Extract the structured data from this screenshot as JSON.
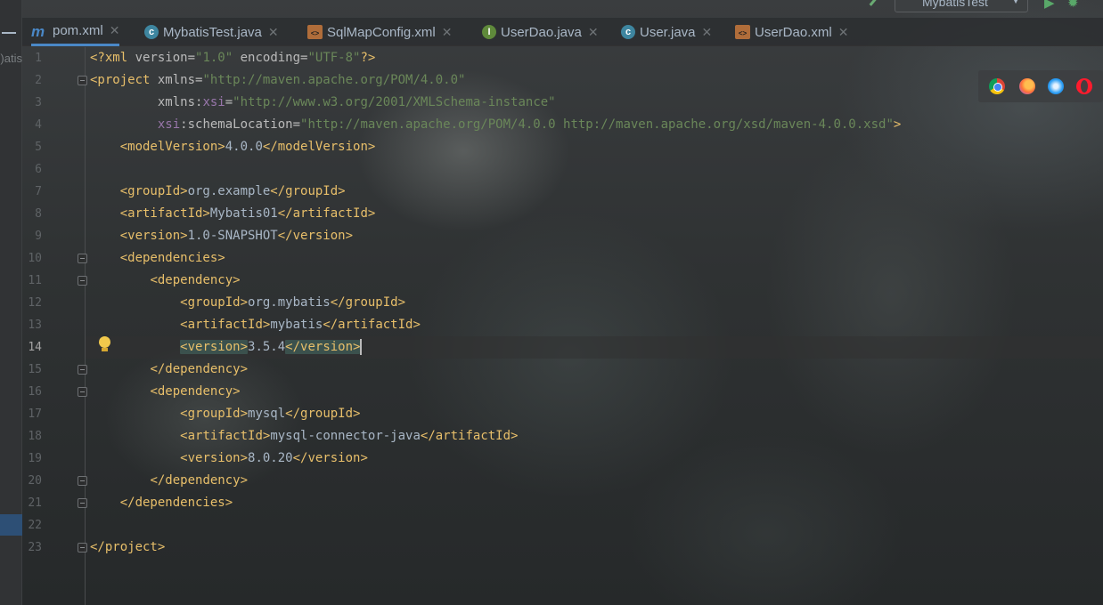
{
  "colors": {
    "tag": "#e8bf6a",
    "attribute": "#bababa",
    "namespace": "#9876aa",
    "string": "#6a8759",
    "text": "#a9b7c6",
    "tab_accent": "#4a88c7"
  },
  "sidebar": {
    "partial_text": "atis("
  },
  "toolbar": {
    "run_config": "MybatisTest",
    "run_icon": "run-triangle-icon",
    "debug_icon": "bug-icon"
  },
  "tabs": [
    {
      "label": "pom.xml",
      "icon": "maven-m-icon",
      "active": true
    },
    {
      "label": "MybatisTest.java",
      "icon": "class-c-icon",
      "active": false
    },
    {
      "label": "SqlMapConfig.xml",
      "icon": "xml-file-icon",
      "active": false
    },
    {
      "label": "UserDao.java",
      "icon": "interface-i-icon",
      "active": false
    },
    {
      "label": "User.java",
      "icon": "class-c-icon",
      "active": false
    },
    {
      "label": "UserDao.xml",
      "icon": "xml-file-icon",
      "active": false
    }
  ],
  "browsers": [
    "chrome-icon",
    "firefox-icon",
    "safari-icon",
    "opera-icon"
  ],
  "editor": {
    "current_line": 14,
    "lines": [
      {
        "num": "1",
        "indent": "",
        "tokens": [
          {
            "t": "tag",
            "v": "<?xml "
          },
          {
            "t": "attr",
            "v": "version="
          },
          {
            "t": "str",
            "v": "\"1.0\""
          },
          {
            "t": "attr",
            "v": " encoding="
          },
          {
            "t": "str",
            "v": "\"UTF-8\""
          },
          {
            "t": "tag",
            "v": "?>"
          }
        ]
      },
      {
        "num": "2",
        "indent": "",
        "tokens": [
          {
            "t": "tag",
            "v": "<project "
          },
          {
            "t": "attr",
            "v": "xmlns="
          },
          {
            "t": "str",
            "v": "\"http://maven.apache.org/POM/4.0.0\""
          }
        ]
      },
      {
        "num": "3",
        "indent": "         ",
        "tokens": [
          {
            "t": "attr",
            "v": "xmlns:"
          },
          {
            "t": "ns",
            "v": "xsi"
          },
          {
            "t": "attr",
            "v": "="
          },
          {
            "t": "str",
            "v": "\"http://www.w3.org/2001/XMLSchema-instance\""
          }
        ]
      },
      {
        "num": "4",
        "indent": "         ",
        "tokens": [
          {
            "t": "ns",
            "v": "xsi"
          },
          {
            "t": "attr",
            "v": ":schemaLocation="
          },
          {
            "t": "str",
            "v": "\"http://maven.apache.org/POM/4.0.0 http://maven.apache.org/xsd/maven-4.0.0.xsd\""
          },
          {
            "t": "tag",
            "v": ">"
          }
        ]
      },
      {
        "num": "5",
        "indent": "    ",
        "tokens": [
          {
            "t": "tag",
            "v": "<modelVersion>"
          },
          {
            "t": "text",
            "v": "4.0.0"
          },
          {
            "t": "tag",
            "v": "</modelVersion>"
          }
        ]
      },
      {
        "num": "6",
        "indent": "",
        "tokens": []
      },
      {
        "num": "7",
        "indent": "    ",
        "tokens": [
          {
            "t": "tag",
            "v": "<groupId>"
          },
          {
            "t": "text",
            "v": "org.example"
          },
          {
            "t": "tag",
            "v": "</groupId>"
          }
        ]
      },
      {
        "num": "8",
        "indent": "    ",
        "tokens": [
          {
            "t": "tag",
            "v": "<artifactId>"
          },
          {
            "t": "text",
            "v": "Mybatis01"
          },
          {
            "t": "tag",
            "v": "</artifactId>"
          }
        ]
      },
      {
        "num": "9",
        "indent": "    ",
        "tokens": [
          {
            "t": "tag",
            "v": "<version>"
          },
          {
            "t": "text",
            "v": "1.0-SNAPSHOT"
          },
          {
            "t": "tag",
            "v": "</version>"
          }
        ]
      },
      {
        "num": "10",
        "indent": "    ",
        "tokens": [
          {
            "t": "tag",
            "v": "<dependencies>"
          }
        ]
      },
      {
        "num": "11",
        "indent": "        ",
        "tokens": [
          {
            "t": "tag",
            "v": "<dependency>"
          }
        ]
      },
      {
        "num": "12",
        "indent": "            ",
        "tokens": [
          {
            "t": "tag",
            "v": "<groupId>"
          },
          {
            "t": "text",
            "v": "org.mybatis"
          },
          {
            "t": "tag",
            "v": "</groupId>"
          }
        ]
      },
      {
        "num": "13",
        "indent": "            ",
        "tokens": [
          {
            "t": "tag",
            "v": "<artifactId>"
          },
          {
            "t": "text",
            "v": "mybatis"
          },
          {
            "t": "tag",
            "v": "</artifactId>"
          }
        ]
      },
      {
        "num": "14",
        "indent": "            ",
        "tokens": [
          {
            "t": "tag",
            "v": "<version>",
            "match": true
          },
          {
            "t": "text",
            "v": "3.5.4"
          },
          {
            "t": "tag",
            "v": "</version>",
            "match": true
          },
          {
            "t": "caret",
            "v": ""
          }
        ]
      },
      {
        "num": "15",
        "indent": "        ",
        "tokens": [
          {
            "t": "tag",
            "v": "</dependency>"
          }
        ]
      },
      {
        "num": "16",
        "indent": "        ",
        "tokens": [
          {
            "t": "tag",
            "v": "<dependency>"
          }
        ]
      },
      {
        "num": "17",
        "indent": "            ",
        "tokens": [
          {
            "t": "tag",
            "v": "<groupId>"
          },
          {
            "t": "text",
            "v": "mysql"
          },
          {
            "t": "tag",
            "v": "</groupId>"
          }
        ]
      },
      {
        "num": "18",
        "indent": "            ",
        "tokens": [
          {
            "t": "tag",
            "v": "<artifactId>"
          },
          {
            "t": "text",
            "v": "mysql-connector-java"
          },
          {
            "t": "tag",
            "v": "</artifactId>"
          }
        ]
      },
      {
        "num": "19",
        "indent": "            ",
        "tokens": [
          {
            "t": "tag",
            "v": "<version>"
          },
          {
            "t": "text",
            "v": "8.0.20"
          },
          {
            "t": "tag",
            "v": "</version>"
          }
        ]
      },
      {
        "num": "20",
        "indent": "        ",
        "tokens": [
          {
            "t": "tag",
            "v": "</dependency>"
          }
        ]
      },
      {
        "num": "21",
        "indent": "    ",
        "tokens": [
          {
            "t": "tag",
            "v": "</dependencies>"
          }
        ]
      },
      {
        "num": "22",
        "indent": "",
        "tokens": []
      },
      {
        "num": "23",
        "indent": "",
        "tokens": [
          {
            "t": "tag",
            "v": "</project>"
          }
        ]
      }
    ],
    "fold_lines": [
      2,
      10,
      11,
      15,
      16,
      20,
      21,
      23
    ]
  }
}
